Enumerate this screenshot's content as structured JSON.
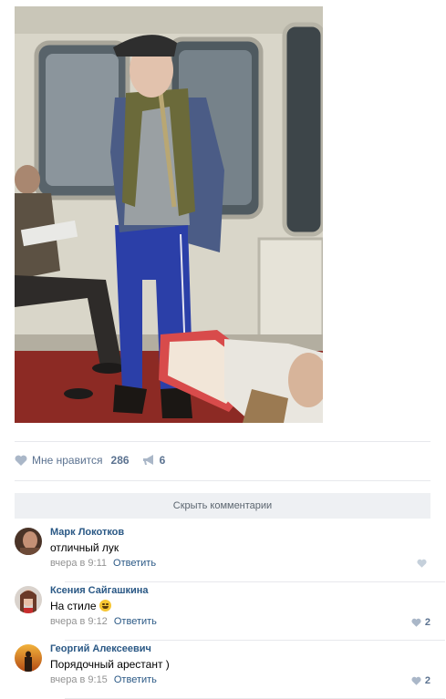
{
  "post": {
    "photo_icon": "subway-photo",
    "likes_label": "Мне нравится",
    "likes_count": "286",
    "shares_count": "6"
  },
  "comments_toggle": "Скрыть комментарии",
  "comments": [
    {
      "author": "Марк Локотков",
      "text": "отличный лук",
      "time": "вчера в 9:11",
      "reply": "Ответить",
      "likes": ""
    },
    {
      "author": "Ксения Сайгашкина",
      "text": "На стиле",
      "emoji": "laughing-emoji",
      "time": "вчера в 9:12",
      "reply": "Ответить",
      "likes": "2"
    },
    {
      "author": "Георгий Алексеевич",
      "text": "Порядочный арестант )",
      "time": "вчера в 9:15",
      "reply": "Ответить",
      "likes": "2"
    }
  ],
  "colors": {
    "link": "#2a5885",
    "muted": "#939393",
    "action": "#5b7290",
    "divider": "#e7e8ec",
    "bar": "#eef0f3"
  }
}
